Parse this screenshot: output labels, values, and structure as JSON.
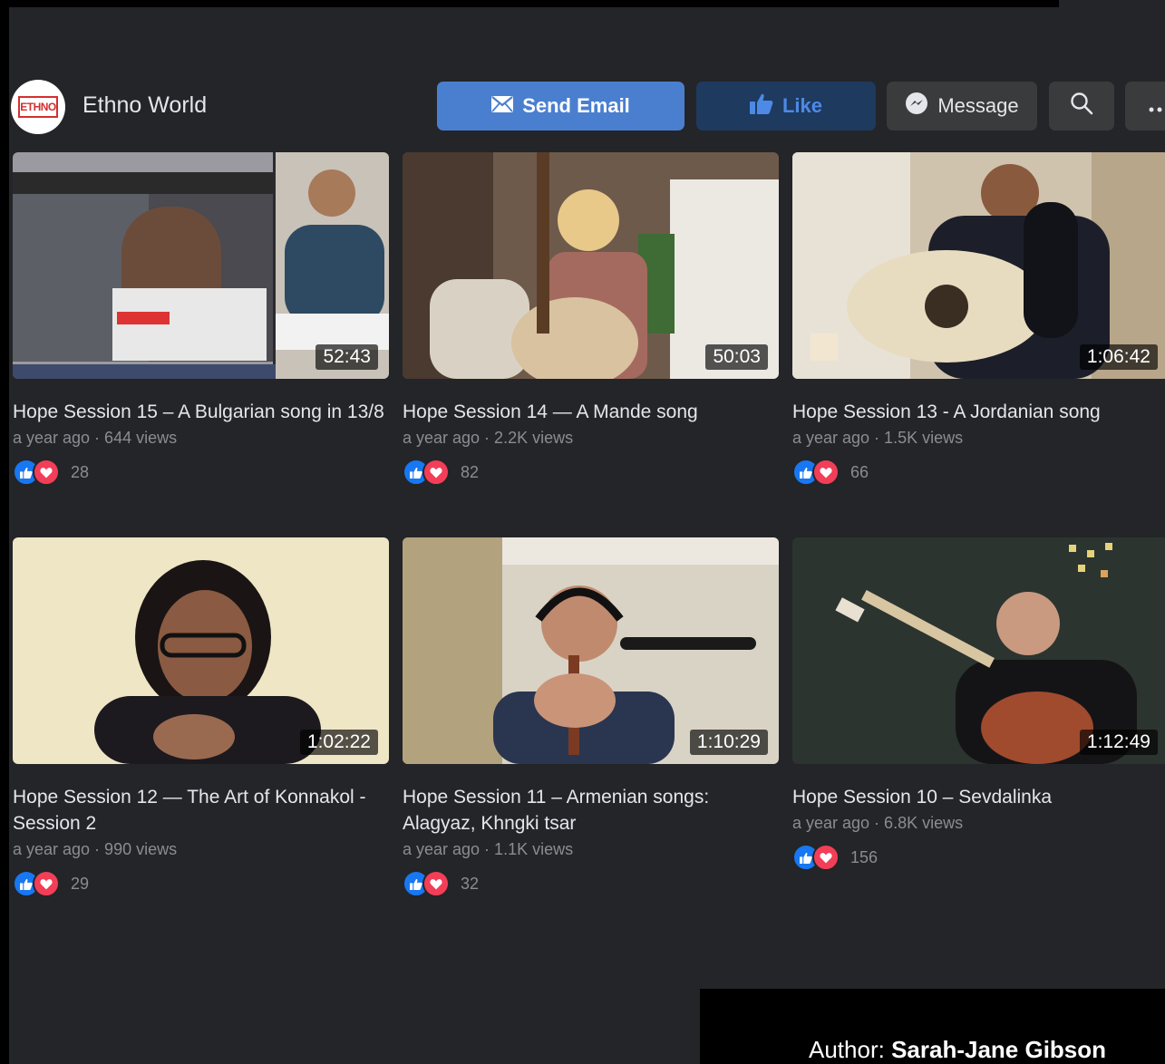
{
  "page": {
    "name": "Ethno World",
    "logo_text": "ETHNO"
  },
  "actions": {
    "send_email": "Send Email",
    "like": "Like",
    "message": "Message"
  },
  "colors": {
    "background": "#232528",
    "primary_button": "#4a7fd0",
    "like_button": "#1e3a5f",
    "like_text": "#4d8ae6",
    "secondary_button": "#3a3b3c",
    "like_reaction": "#1877f2",
    "love_reaction": "#f33e58"
  },
  "videos": [
    {
      "title": "Hope Session 15 – A Bulgarian song in 13/8",
      "meta": "a year ago · 644 views",
      "reactions": "28",
      "duration": "52:43"
    },
    {
      "title": "Hope Session 14 — A Mande song",
      "meta": "a year ago · 2.2K views",
      "reactions": "82",
      "duration": "50:03"
    },
    {
      "title": "Hope Session 13 - A Jordanian song",
      "meta": "a year ago · 1.5K views",
      "reactions": "66",
      "duration": "1:06:42"
    },
    {
      "title": "Hope Session 12 — The Art of Konnakol - Session 2",
      "meta": "a year ago · 990 views",
      "reactions": "29",
      "duration": "1:02:22"
    },
    {
      "title": "Hope Session 11 – Armenian songs: Alagyaz, Khngki tsar",
      "meta": "a year ago · 1.1K views",
      "reactions": "32",
      "duration": "1:10:29"
    },
    {
      "title": "Hope Session 10 – Sevdalinka",
      "meta": "a year ago · 6.8K views",
      "reactions": "156",
      "duration": "1:12:49"
    }
  ],
  "author": {
    "label": "Author: ",
    "name": "Sarah-Jane Gibson"
  }
}
